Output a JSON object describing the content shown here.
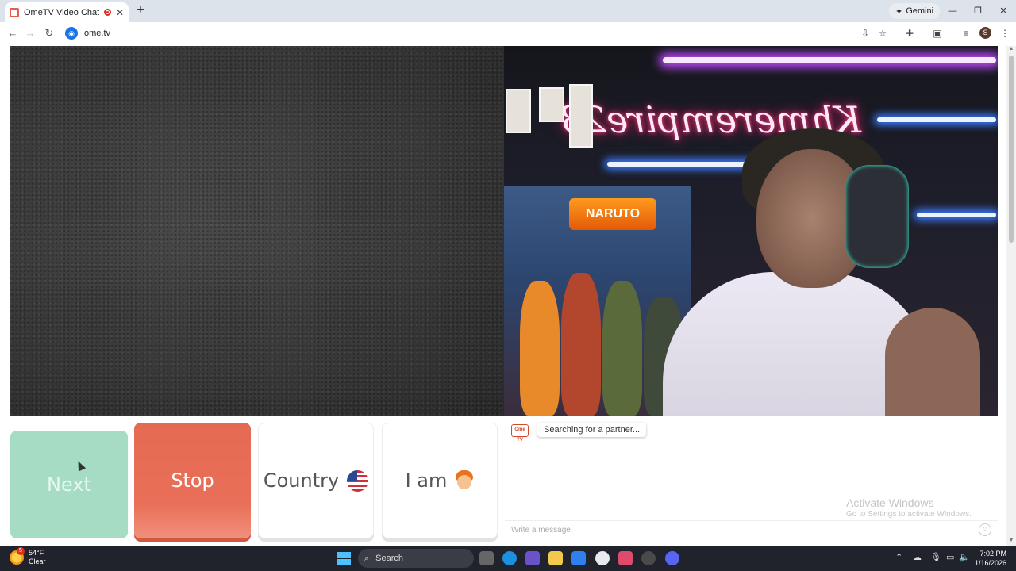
{
  "browser": {
    "tab_title": "OmeTV Video Chat — Ome",
    "tab_close": "✕",
    "new_tab": "+",
    "gemini_label": "Gemini",
    "url": "ome.tv",
    "win_minimize": "—",
    "win_restore": "❐",
    "win_close": "✕"
  },
  "video": {
    "sign_text": "Khmerempire23",
    "poster_text": "NARUTO"
  },
  "controls": {
    "next_label": "Next",
    "stop_label": "Stop",
    "country_label": "Country",
    "iam_label": "I am"
  },
  "chat": {
    "logo_text": "Ome TV",
    "status_message": "Searching for a partner...",
    "input_placeholder": "Write a message",
    "watermark_title": "Activate Windows",
    "watermark_sub": "Go to Settings to activate Windows."
  },
  "taskbar": {
    "weather_temp": "54°F",
    "weather_cond": "Clear",
    "weather_badge": "5",
    "search_placeholder": "Search",
    "time": "7:02 PM",
    "date": "1/16/2026"
  },
  "colors": {
    "stop": "#e66a53",
    "next": "#a5dcc3",
    "accent": "#d9472f"
  }
}
